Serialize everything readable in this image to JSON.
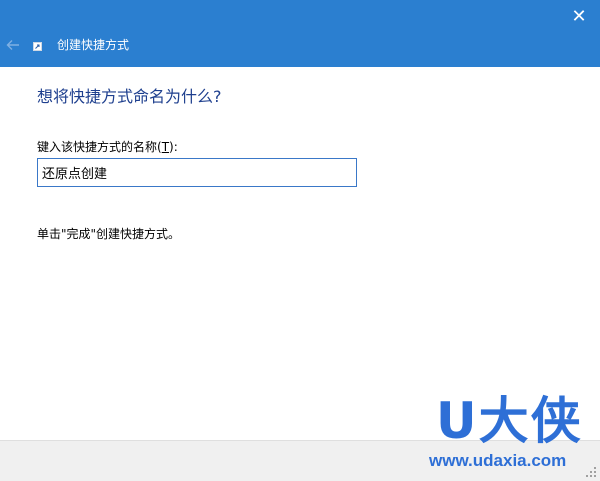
{
  "window": {
    "title": "创建快捷方式",
    "close_glyph": "✕",
    "back_icon": "back-arrow-icon",
    "app_icon": "shortcut-icon",
    "accent_color": "#2b7fd0"
  },
  "wizard": {
    "heading": "想将快捷方式命名为什么?",
    "field_label": "键入该快捷方式的名称",
    "field_mnemonic_open": "(",
    "field_mnemonic": "T",
    "field_mnemonic_close": "):",
    "name_value": "还原点创建",
    "hint": "单击\"完成\"创建快捷方式。"
  },
  "watermark": {
    "brand": "U大侠",
    "url": "www.udaxia.com",
    "color": "#2e6fd6"
  }
}
